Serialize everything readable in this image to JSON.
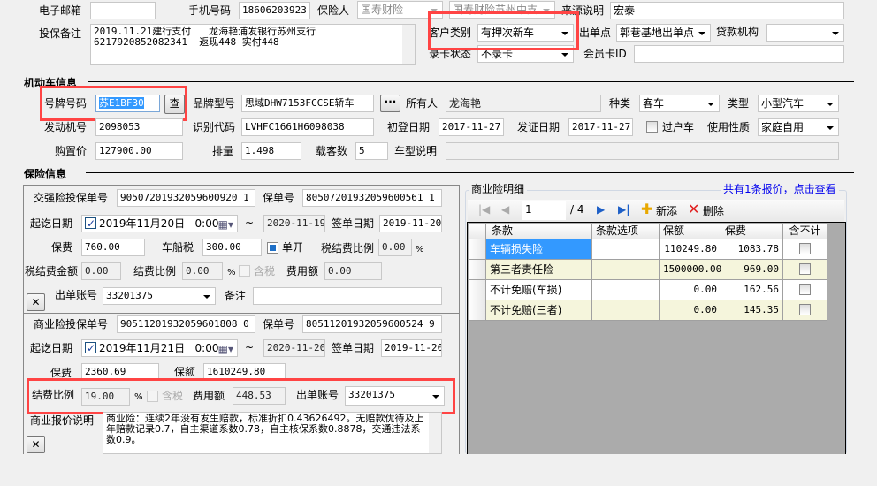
{
  "contact": {
    "email_label": "电子邮箱",
    "email_value": "",
    "phone_label": "手机号码",
    "phone_value": "18606203923",
    "insurer_label": "保险人",
    "insurer_value": "国寿财险",
    "branch_value": "国寿财险苏州中支",
    "source_label": "来源说明",
    "source_value": "宏泰",
    "remark_label": "投保备注",
    "remark_value": "2019.11.21建行支付   龙海艳浦发银行苏州支行\n6217920852082341  返现448 实付448",
    "customer_type_label": "客户类别",
    "customer_type_value": "有押次新车",
    "issue_point_label": "出单点",
    "issue_point_value": "郭巷基地出单点",
    "loan_org_label": "贷款机构",
    "loan_org_value": "",
    "card_status_label": "录卡状态",
    "card_status_value": "不录卡",
    "member_card_label": "会员卡ID",
    "member_card_value": ""
  },
  "vehicle": {
    "section_title": "机动车信息",
    "plate_label": "号牌号码",
    "plate_value": "苏E1BF30",
    "lookup_button": "查",
    "brand_label": "品牌型号",
    "brand_value": "思域DHW7153FCCSE轿车",
    "more_button": "···",
    "owner_label": "所有人",
    "owner_value": "龙海艳",
    "kind_label": "种类",
    "kind_value": "客车",
    "type_label": "类型",
    "type_value": "小型汽车",
    "engine_label": "发动机号",
    "engine_value": "2098053",
    "vin_label": "识别代码",
    "vin_value": "LVHFC1661H6098038",
    "reg_date_label": "初登日期",
    "reg_date_value": "2017-11-27",
    "cert_date_label": "发证日期",
    "cert_date_value": "2017-11-27",
    "transfer_label": "过户车",
    "usage_label": "使用性质",
    "usage_value": "家庭自用",
    "price_label": "购置价",
    "price_value": "127900.00",
    "displacement_label": "排量",
    "displacement_value": "1.498",
    "seats_label": "载客数",
    "seats_value": "5",
    "model_desc_label": "车型说明",
    "model_desc_value": ""
  },
  "insurance": {
    "section_title": "保险信息",
    "compulsory": {
      "app_no_label": "交强险投保单号",
      "app_no_value": "90507201932059600920 1",
      "policy_no_label": "保单号",
      "policy_no_value": "80507201932059600561 1",
      "period_label": "起讫日期",
      "start_value": "2019年11月20日   0:00",
      "tilde": "~",
      "end_value": "2020-11-19",
      "sign_date_label": "签单日期",
      "sign_date_value": "2019-11-20",
      "premium_label": "保费",
      "premium_value": "760.00",
      "vessel_tax_label": "车船税",
      "vessel_tax_value": "300.00",
      "separate_label": "单开",
      "tax_fee_ratio_label": "税结费比例",
      "tax_fee_ratio_value": "0.00",
      "percent": "%",
      "tax_fee_amount_label": "税结费金额",
      "tax_fee_amount_value": "0.00",
      "fee_ratio_label": "结费比例",
      "fee_ratio_value": "0.00",
      "incl_tax_label": "含税",
      "fee_amount_label": "费用额",
      "fee_amount_value": "0.00",
      "account_label": "出单账号",
      "account_value": "33201375",
      "note_label": "备注",
      "note_value": "",
      "close_button": "✕"
    },
    "commercial": {
      "app_no_label": "商业险投保单号",
      "app_no_value": "90511201932059601808 0",
      "policy_no_label": "保单号",
      "policy_no_value": "80511201932059600524 9",
      "period_label": "起讫日期",
      "start_value": "2019年11月21日   0:00",
      "tilde": "~",
      "end_value": "2020-11-20",
      "sign_date_label": "签单日期",
      "sign_date_value": "2019-11-20",
      "premium_label": "保费",
      "premium_value": "2360.69",
      "coverage_label": "保额",
      "coverage_value": "1610249.80",
      "fee_ratio_label": "结费比例",
      "fee_ratio_value": "19.00",
      "percent": "%",
      "incl_tax_label": "含税",
      "fee_amount_label": "费用额",
      "fee_amount_value": "448.53",
      "account_label": "出单账号",
      "account_value": "33201375",
      "quote_desc_label": "商业报价说明",
      "quote_desc_value": "商业险：连续2年没有发生赔款，标准折扣0.43626492。无赔款优待及上年赔款记录0.7，自主渠道系数0.78，自主核保系数0.8878，交通违法系数0.9。",
      "close_button": "✕"
    }
  },
  "detail": {
    "title": "商业险明细",
    "quote_link": "共有1条报价，点击查看",
    "pager": {
      "current": "1",
      "total": "/ 4",
      "add": "新添",
      "delete": "删除"
    },
    "columns": [
      "条款",
      "条款选项",
      "保额",
      "保费",
      "含不计"
    ],
    "rows": [
      {
        "clause": "车辆损失险",
        "option": "",
        "coverage": "110249.80",
        "premium": "1083.78"
      },
      {
        "clause": "第三者责任险",
        "option": "",
        "coverage": "1500000.00",
        "premium": "969.00"
      },
      {
        "clause": "不计免赔(车损)",
        "option": "",
        "coverage": "0.00",
        "premium": "162.56"
      },
      {
        "clause": "不计免赔(三者)",
        "option": "",
        "coverage": "0.00",
        "premium": "145.35"
      }
    ]
  }
}
